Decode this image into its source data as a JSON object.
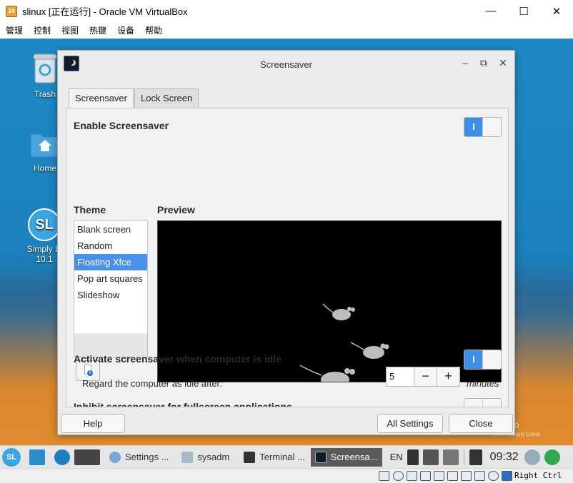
{
  "host": {
    "title": "slinux [正在运行] - Oracle VM VirtualBox",
    "app_icon_text": "24",
    "controls": {
      "minimize": "—",
      "maximize": "☐",
      "close": "✕"
    },
    "menu": [
      "管理",
      "控制",
      "视图",
      "热键",
      "设备",
      "帮助"
    ],
    "status": {
      "host_key": "Right Ctrl"
    }
  },
  "desktop": {
    "icons": [
      {
        "label": "Trash",
        "icon": "trash-icon"
      },
      {
        "label": "Home",
        "icon": "folder-home-icon"
      },
      {
        "label": "Simply Linux\n10.1",
        "label_line1": "Simply Li",
        "label_line2": "10.1",
        "badge": "SL",
        "icon": "simply-linux-icon"
      }
    ],
    "watermark": {
      "line1": "studio",
      "line2": "from Simply Linux"
    }
  },
  "dialog": {
    "title": "Screensaver",
    "controls": {
      "minimize": "–",
      "maximize": "⧉",
      "close": "✕"
    },
    "tabs": [
      {
        "label": "Screensaver",
        "active": true
      },
      {
        "label": "Lock Screen",
        "active": false
      }
    ],
    "enable_label": "Enable Screensaver",
    "enable_on": true,
    "toggle_on_glyph": "I",
    "theme_heading": "Theme",
    "preview_heading": "Preview",
    "themes": [
      {
        "label": "Blank screen",
        "selected": false
      },
      {
        "label": "Random",
        "selected": false
      },
      {
        "label": "Floating Xfce",
        "selected": true
      },
      {
        "label": "Pop art squares",
        "selected": false
      },
      {
        "label": "Slideshow",
        "selected": false
      }
    ],
    "info_glyph": "i",
    "activate_label": "Activate screensaver when computer is idle",
    "activate_on": true,
    "idle_label": "Regard the computer as idle after:",
    "idle_value": "5",
    "minus": "−",
    "plus": "+",
    "idle_unit": "minutes",
    "inhibit_label": "Inhibit screensaver for fullscreen applications",
    "buttons": {
      "help": "Help",
      "all_settings": "All Settings",
      "close": "Close"
    }
  },
  "taskbar": {
    "tasks": [
      {
        "label": "Settings ...",
        "active": false
      },
      {
        "label": "sysadm",
        "active": false
      },
      {
        "label": "Terminal ...",
        "active": false
      },
      {
        "label": "Screensa...",
        "active": true
      }
    ],
    "lang": "EN",
    "clock": "09:32",
    "menu_badge": "SL"
  }
}
